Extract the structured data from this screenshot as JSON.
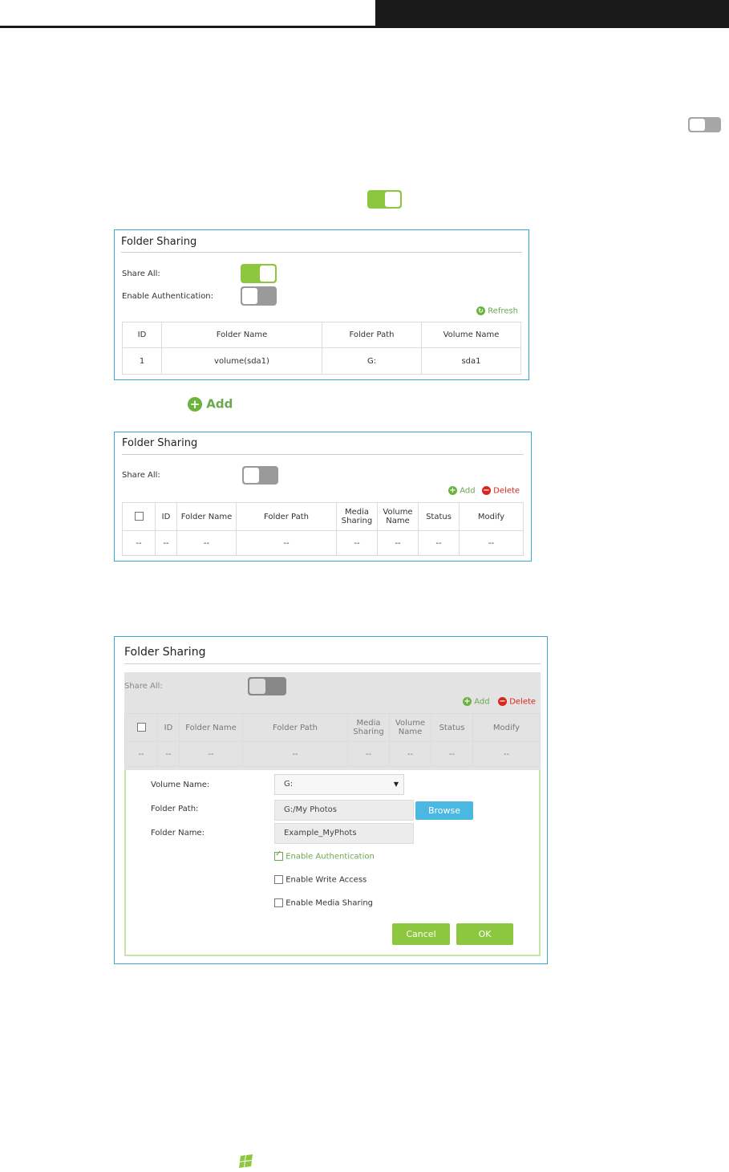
{
  "colors": {
    "accent_green": "#8dc63f",
    "accent_blue": "#3aa6d8",
    "delete_red": "#d9251c",
    "browse_blue": "#4ab8e0"
  },
  "inline_add": {
    "icon": "plus-circle-icon",
    "label": "Add"
  },
  "panel1": {
    "title": "Folder Sharing",
    "share_all_label": "Share All:",
    "auth_label": "Enable Authentication:",
    "share_all_state": "on",
    "auth_state": "off",
    "refresh_label": "Refresh",
    "headers": [
      "ID",
      "Folder Name",
      "Folder Path",
      "Volume Name"
    ],
    "rows": [
      [
        "1",
        "volume(sda1)",
        "G:",
        "sda1"
      ]
    ]
  },
  "panel2": {
    "title": "Folder Sharing",
    "share_all_label": "Share All:",
    "share_all_state": "off",
    "add_label": "Add",
    "delete_label": "Delete",
    "headers": [
      "ID",
      "Folder Name",
      "Folder Path",
      "Media Sharing",
      "Volume Name",
      "Status",
      "Modify"
    ],
    "empty_row": [
      "--",
      "--",
      "--",
      "--",
      "--",
      "--",
      "--",
      "--"
    ]
  },
  "panel3": {
    "title": "Folder Sharing",
    "share_all_label": "Share All:",
    "share_all_state": "off",
    "add_label": "Add",
    "delete_label": "Delete",
    "headers": [
      "ID",
      "Folder Name",
      "Folder Path",
      "Media Sharing",
      "Volume Name",
      "Status",
      "Modify"
    ],
    "empty_row": [
      "--",
      "--",
      "--",
      "--",
      "--",
      "--",
      "--",
      "--"
    ],
    "form": {
      "volume_label": "Volume Name:",
      "volume_value": "G:",
      "path_label": "Folder Path:",
      "path_value": "G:/My Photos",
      "browse_label": "Browse",
      "name_label": "Folder Name:",
      "name_value": "Example_MyPhots",
      "enable_auth_label": "Enable Authentication",
      "enable_auth_checked": true,
      "write_access_label": "Enable Write Access",
      "write_access_checked": false,
      "media_sharing_label": "Enable Media Sharing",
      "media_sharing_checked": false,
      "cancel_label": "Cancel",
      "ok_label": "OK"
    }
  }
}
